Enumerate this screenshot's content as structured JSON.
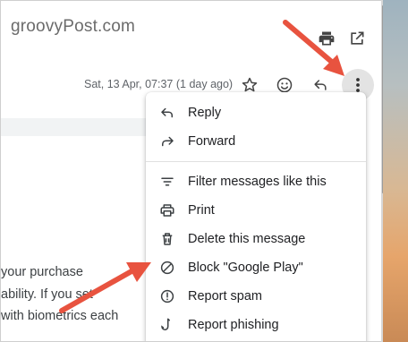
{
  "watermark": "groovyPost.com",
  "header": {
    "print_icon": "print-icon",
    "open_new_window_icon": "open-in-new-window-icon"
  },
  "message": {
    "date": "Sat, 13 Apr, 07:37 (1 day ago)",
    "star_icon": "star-icon",
    "emoji_icon": "emoji-icon",
    "reply_icon": "reply-icon",
    "more_icon": "more-vert-icon"
  },
  "body_lines": [
    "your purchase",
    "ability. If you set",
    "with biometrics each"
  ],
  "menu": {
    "items": [
      {
        "label": "Reply",
        "icon": "reply-icon"
      },
      {
        "label": "Forward",
        "icon": "forward-icon"
      },
      {
        "label": "Filter messages like this",
        "icon": "filter-icon"
      },
      {
        "label": "Print",
        "icon": "print-icon"
      },
      {
        "label": "Delete this message",
        "icon": "trash-icon"
      },
      {
        "label": "Block \"Google Play\"",
        "icon": "block-icon"
      },
      {
        "label": "Report spam",
        "icon": "report-spam-icon"
      },
      {
        "label": "Report phishing",
        "icon": "phishing-hook-icon"
      }
    ]
  },
  "colors": {
    "arrow": "#e8533f",
    "more_button_bg": "#e3e3e3",
    "menu_bg": "#ffffff"
  }
}
